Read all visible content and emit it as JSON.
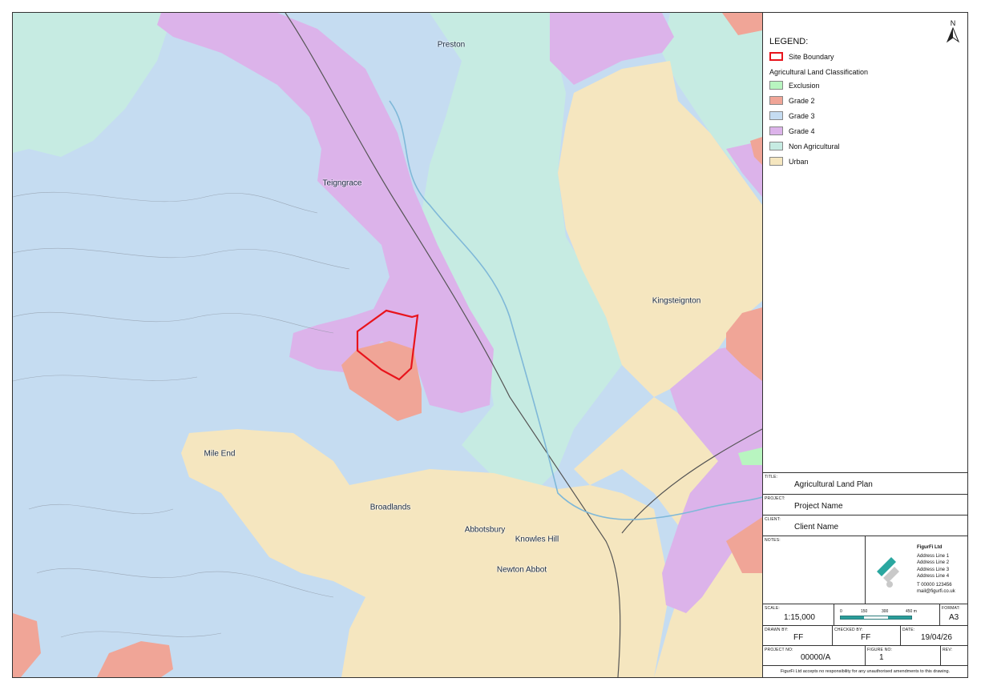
{
  "map": {
    "places": [
      {
        "id": "preston",
        "name": "Preston"
      },
      {
        "id": "teigngrace",
        "name": "Teigngrace"
      },
      {
        "id": "kingsteignton",
        "name": "Kingsteignton"
      },
      {
        "id": "mile-end",
        "name": "Mile End"
      },
      {
        "id": "broadlands",
        "name": "Broadlands"
      },
      {
        "id": "abbotsbury",
        "name": "Abbotsbury"
      },
      {
        "id": "knowles-hill",
        "name": "Knowles Hill"
      },
      {
        "id": "newton-abbot",
        "name": "Newton Abbot"
      }
    ],
    "colors": {
      "grade3": "#c5dcf1",
      "grade4": "#dcb3ea",
      "grade2": "#f0a597",
      "non_agri": "#c6ebe2",
      "urban": "#f5e6bf",
      "exclusion": "#b8f5c0",
      "site": "#e8141c"
    }
  },
  "legend": {
    "north": "N",
    "title": "LEGEND:",
    "site_boundary": "Site Boundary",
    "subtitle": "Agricultural Land Classification",
    "items": [
      {
        "label": "Exclusion",
        "color": "#b8f5c0"
      },
      {
        "label": "Grade 2",
        "color": "#f0a597"
      },
      {
        "label": "Grade 3",
        "color": "#c5dcf1"
      },
      {
        "label": "Grade 4",
        "color": "#dcb3ea"
      },
      {
        "label": "Non Agricultural",
        "color": "#c6ebe2"
      },
      {
        "label": "Urban",
        "color": "#f5e6bf"
      }
    ]
  },
  "titleblock": {
    "title_label": "TITLE:",
    "title": "Agricultural Land Plan",
    "project_label": "PROJECT:",
    "project": "Project Name",
    "client_label": "CLIENT:",
    "client": "Client Name",
    "notes_label": "NOTES:",
    "company": "FigurFi Ltd",
    "address": [
      "Address Line 1",
      "Address Line 2",
      "Address Line 3",
      "Address Line 4"
    ],
    "phone": "T  00000 123456",
    "email": "mail@figurfi.co.uk",
    "scale_label": "SCALE:",
    "scale": "1:15,000",
    "scalebar": [
      "0",
      "150",
      "300",
      "450 m"
    ],
    "format_label": "FORMAT:",
    "format": "A3",
    "drawn_label": "DRAWN BY:",
    "drawn": "FF",
    "checked_label": "CHECKED BY:",
    "checked": "FF",
    "date_label": "DATE:",
    "date": "19/04/26",
    "projectno_label": "PROJECT NO:",
    "projectno": "00000/A",
    "figure_label": "FIGURE NO:",
    "figure": "1",
    "rev_label": "REV:",
    "rev": "",
    "disclaimer": "FigurFi Ltd accepts no responsibility for any unauthorised amendments to this drawing."
  }
}
